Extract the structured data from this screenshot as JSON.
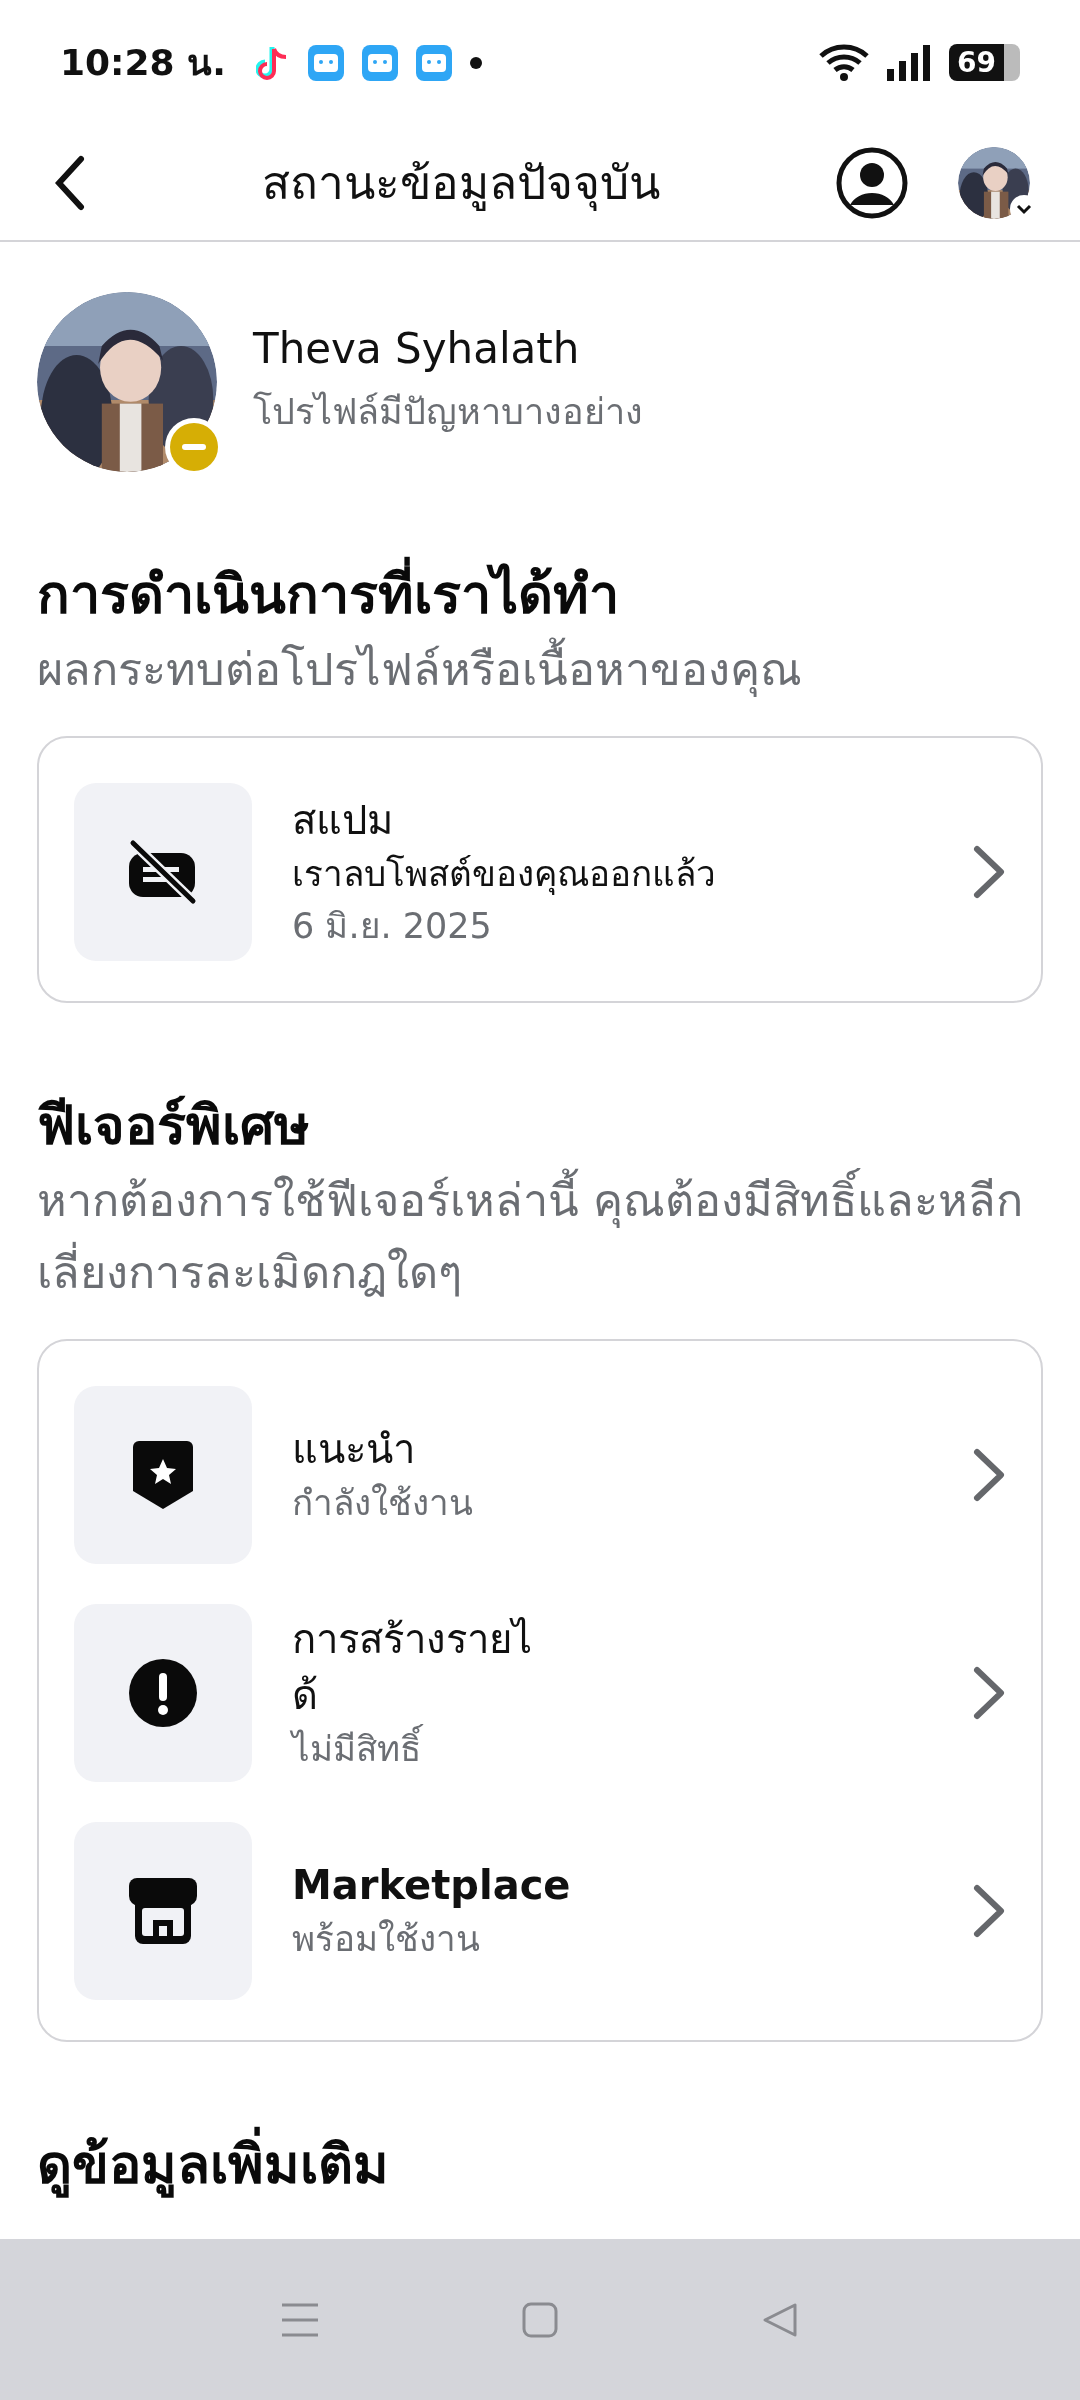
{
  "status_bar": {
    "time": "10:28 น.",
    "battery": "69"
  },
  "header": {
    "title": "สถานะข้อมูลปัจจุบัน"
  },
  "profile": {
    "name": "Theva Syhalath",
    "status": "โปรไฟล์มีปัญหาบางอย่าง"
  },
  "sections": [
    {
      "title": "การดำเนินการที่เราได้ทำ",
      "subtitle": "ผลกระทบต่อโปรไฟล์หรือเนื้อหาของคุณ",
      "items": [
        {
          "kind": "spam",
          "title": "สแปม",
          "description": "เราลบโพสต์ของคุณออกแล้ว",
          "date": "6 มิ.ย. 2025"
        }
      ]
    },
    {
      "title": "ฟีเจอร์พิเศษ",
      "subtitle": "หากต้องการใช้ฟีเจอร์เหล่านี้ คุณต้องมีสิทธิ์และหลีกเลี่ยงการละเมิดกฎใดๆ",
      "items": [
        {
          "kind": "badge",
          "title": "แนะนำ",
          "description": "กำลังใช้งาน"
        },
        {
          "kind": "alert",
          "title": "การสร้างรายได้",
          "description": "ไม่มีสิทธิ์"
        },
        {
          "kind": "shop",
          "title": "Marketplace",
          "description": "พร้อมใช้งาน"
        }
      ]
    },
    {
      "title": "ดูข้อมูลเพิ่มเติม"
    }
  ]
}
